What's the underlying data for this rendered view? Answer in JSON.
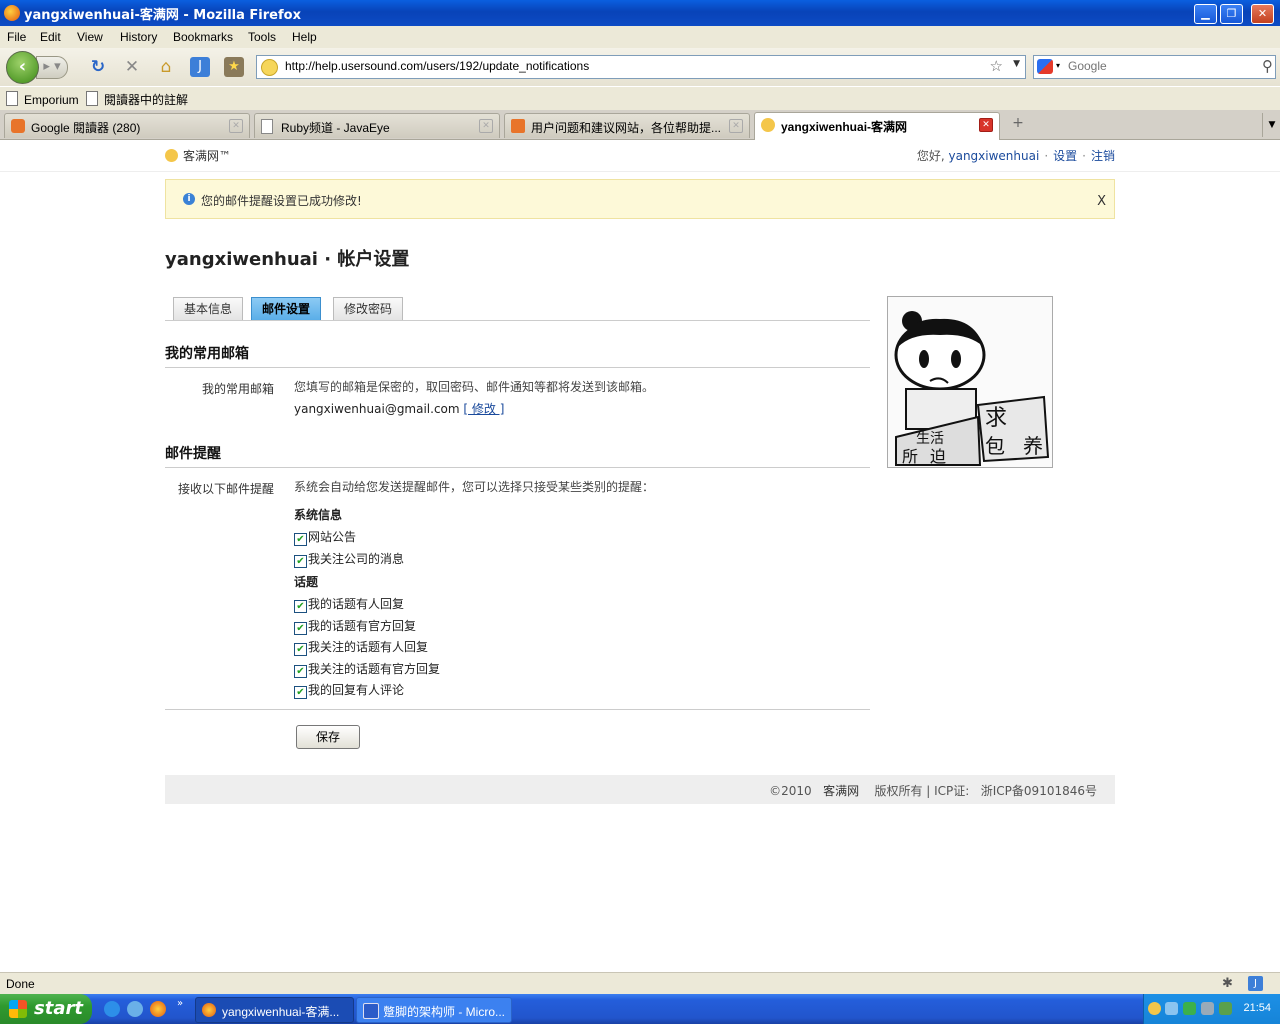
{
  "window": {
    "title": "yangxiwenhuai-客满网 - Mozilla Firefox",
    "controls": {
      "minimize": "▁",
      "maximize": "❐",
      "close": "✕"
    }
  },
  "menu": [
    "File",
    "Edit",
    "View",
    "History",
    "Bookmarks",
    "Tools",
    "Help"
  ],
  "navbar": {
    "url": "http://help.usersound.com/users/192/update_notifications",
    "search_placeholder": "Google"
  },
  "bookmarks": [
    "Emporium",
    "閱讀器中的註解"
  ],
  "tabs": [
    {
      "label": "Google 閱讀器 (280)",
      "active": false
    },
    {
      "label": "Ruby频道 - JavaEye",
      "active": false
    },
    {
      "label": "用户问题和建议网站，各位帮助提...",
      "active": false
    },
    {
      "label": "yangxiwenhuai-客满网",
      "active": true
    }
  ],
  "site": {
    "logo": "客满网™",
    "greeting": "您好, ",
    "username": "yangxiwenhuai",
    "settings_link": "设置",
    "logout_link": "注销",
    "separator": "·"
  },
  "notice": {
    "message": "您的邮件提醒设置已成功修改!",
    "close": "X"
  },
  "heading": "yangxiwenhuai · 帐户设置",
  "settings_tabs": [
    {
      "label": "基本信息",
      "active": false
    },
    {
      "label": "邮件设置",
      "active": true
    },
    {
      "label": "修改密码",
      "active": false
    }
  ],
  "email_section": {
    "title": "我的常用邮箱",
    "label": "我的常用邮箱",
    "description": "您填写的邮箱是保密的，取回密码、邮件通知等都将发送到该邮箱。",
    "email": "yangxiwenhuai@gmail.com",
    "edit_link": "[ 修改 ]"
  },
  "reminder_section": {
    "title": "邮件提醒",
    "label": "接收以下邮件提醒",
    "description": "系统会自动给您发送提醒邮件，您可以选择只接受某些类别的提醒：",
    "groups": [
      {
        "name": "系统信息",
        "items": [
          {
            "label": "网站公告",
            "checked": true
          },
          {
            "label": "我关注公司的消息",
            "checked": true
          }
        ]
      },
      {
        "name": "话题",
        "items": [
          {
            "label": "我的话题有人回复",
            "checked": true
          },
          {
            "label": "我的话题有官方回复",
            "checked": true
          },
          {
            "label": "我关注的话题有人回复",
            "checked": true
          },
          {
            "label": "我关注的话题有官方回复",
            "checked": true
          },
          {
            "label": "我的回复有人评论",
            "checked": true
          }
        ]
      }
    ]
  },
  "save_button": "保存",
  "avatar_text": {
    "sign": "求包养",
    "desk": "生活所迫"
  },
  "footer": {
    "copyright": "©2010",
    "brand": "客满网",
    "rights": "版权所有 | ICP证:",
    "icp": "浙ICP备09101846号"
  },
  "status": "Done",
  "taskbar": {
    "start": "start",
    "buttons": [
      "yangxiwenhuai-客满...",
      "蹩脚的架构师 - Micro..."
    ],
    "clock": "21:54"
  }
}
